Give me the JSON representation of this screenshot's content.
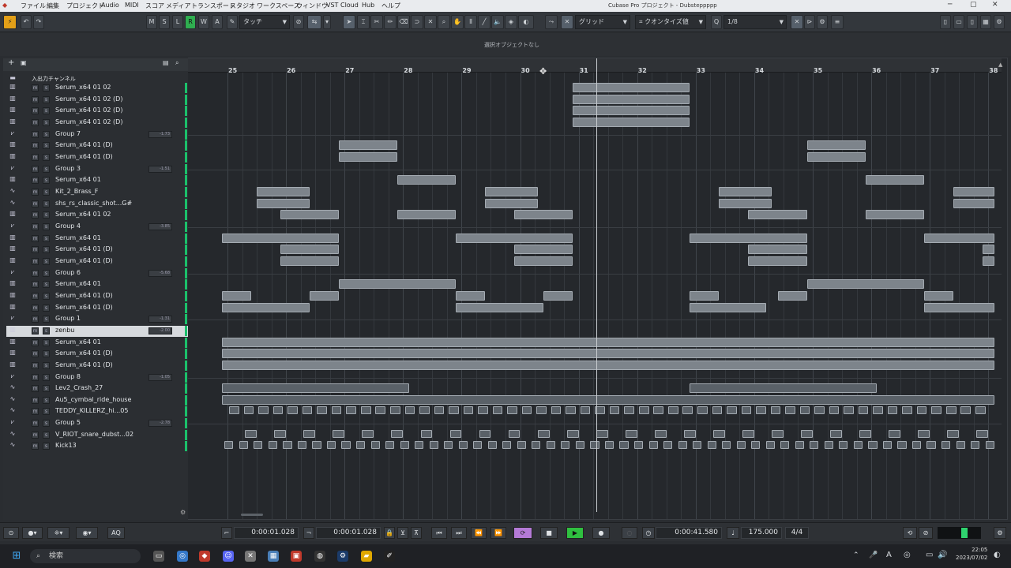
{
  "menu": [
    "ファイル",
    "編集",
    "プロジェクト",
    "Audio",
    "MIDI",
    "スコア",
    "メディア",
    "トランスポート",
    "スタジオ",
    "ワークスペース",
    "ウィンドウ",
    "VST Cloud",
    "Hub",
    "ヘルプ"
  ],
  "window_title": "Cubase Pro プロジェクト - Dubsteppppp",
  "toolbar": {
    "m": "M",
    "s": "S",
    "l": "L",
    "r": "R",
    "w": "W",
    "a": "A",
    "automation_mode": "タッチ",
    "snap_type": "グリッド",
    "quantize_type": "クオンタイズ値",
    "quantize_value": "1/8"
  },
  "info_line": "選択オブジェクトなし",
  "track_header": "入出力チャンネル",
  "tracks": [
    {
      "name": "Serum_x64 01 02",
      "vol": ""
    },
    {
      "name": "Serum_x64 01 02 (D)",
      "vol": ""
    },
    {
      "name": "Serum_x64 01 02 (D)",
      "vol": ""
    },
    {
      "name": "Serum_x64 01 02 (D)",
      "vol": ""
    },
    {
      "name": "Group 7",
      "vol": "-1.73"
    },
    {
      "name": "Serum_x64 01 (D)",
      "vol": ""
    },
    {
      "name": "Serum_x64 01 (D)",
      "vol": ""
    },
    {
      "name": "Group 3",
      "vol": "-1.51"
    },
    {
      "name": "Serum_x64 01",
      "vol": ""
    },
    {
      "name": "Kit_2_Brass_F",
      "vol": ""
    },
    {
      "name": "shs_rs_classic_shot...G#",
      "vol": ""
    },
    {
      "name": "Serum_x64 01 02",
      "vol": ""
    },
    {
      "name": "Group 4",
      "vol": "-3.85"
    },
    {
      "name": "Serum_x64 01",
      "vol": ""
    },
    {
      "name": "Serum_x64 01 (D)",
      "vol": ""
    },
    {
      "name": "Serum_x64 01 (D)",
      "vol": ""
    },
    {
      "name": "Group 6",
      "vol": "-5.68"
    },
    {
      "name": "Serum_x64 01",
      "vol": ""
    },
    {
      "name": "Serum_x64 01 (D)",
      "vol": ""
    },
    {
      "name": "Serum_x64 01 (D)",
      "vol": ""
    },
    {
      "name": "Group 1",
      "vol": "-1.31"
    },
    {
      "name": "zenbu",
      "vol": "-2.00"
    },
    {
      "name": "Serum_x64 01",
      "vol": ""
    },
    {
      "name": "Serum_x64 01 (D)",
      "vol": ""
    },
    {
      "name": "Serum_x64 01 (D)",
      "vol": ""
    },
    {
      "name": "Group 8",
      "vol": "-1.05"
    },
    {
      "name": "Lev2_Crash_27",
      "vol": ""
    },
    {
      "name": "Au5_cymbal_ride_house",
      "vol": ""
    },
    {
      "name": "TEDDY_KILLERZ_hi...05",
      "vol": ""
    },
    {
      "name": "Group 5",
      "vol": "-2.78"
    },
    {
      "name": "V_RIOT_snare_dubst...02",
      "vol": ""
    },
    {
      "name": "Kick13",
      "vol": ""
    }
  ],
  "bars": [
    "25",
    "26",
    "27",
    "28",
    "29",
    "30",
    "31",
    "32",
    "33",
    "34",
    "35",
    "36",
    "37",
    "38"
  ],
  "transport": {
    "left_locator": "0:00:01.028",
    "right_locator": "0:00:01.028",
    "position": "0:00:41.580",
    "tempo": "175.000",
    "signature": "4/4"
  },
  "taskbar": {
    "search": "検索",
    "time": "22:05",
    "date": "2023/07/02"
  }
}
